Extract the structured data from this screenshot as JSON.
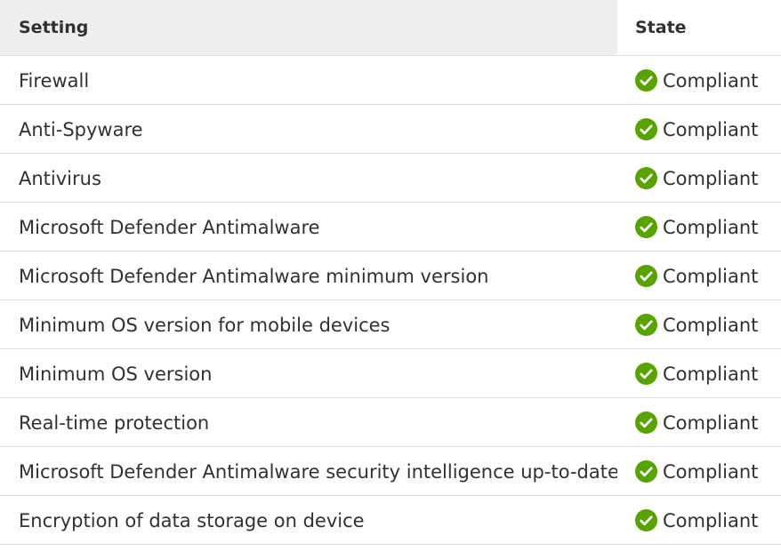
{
  "table": {
    "headers": {
      "setting": "Setting",
      "state": "State"
    },
    "rows": [
      {
        "setting": "Firewall",
        "state": "Compliant",
        "icon": "check-circle-icon"
      },
      {
        "setting": "Anti-Spyware",
        "state": "Compliant",
        "icon": "check-circle-icon"
      },
      {
        "setting": "Antivirus",
        "state": "Compliant",
        "icon": "check-circle-icon"
      },
      {
        "setting": "Microsoft Defender Antimalware",
        "state": "Compliant",
        "icon": "check-circle-icon"
      },
      {
        "setting": "Microsoft Defender Antimalware minimum version",
        "state": "Compliant",
        "icon": "check-circle-icon"
      },
      {
        "setting": "Minimum OS version for mobile devices",
        "state": "Compliant",
        "icon": "check-circle-icon"
      },
      {
        "setting": "Minimum OS version",
        "state": "Compliant",
        "icon": "check-circle-icon"
      },
      {
        "setting": "Real-time protection",
        "state": "Compliant",
        "icon": "check-circle-icon"
      },
      {
        "setting": "Microsoft Defender Antimalware security intelligence up-to-date",
        "state": "Compliant",
        "icon": "check-circle-icon"
      },
      {
        "setting": "Encryption of data storage on device",
        "state": "Compliant",
        "icon": "check-circle-icon"
      }
    ]
  },
  "colors": {
    "compliant_green": "#57a300",
    "header_bg": "#eeeeee",
    "divider": "#e1dfdd"
  }
}
